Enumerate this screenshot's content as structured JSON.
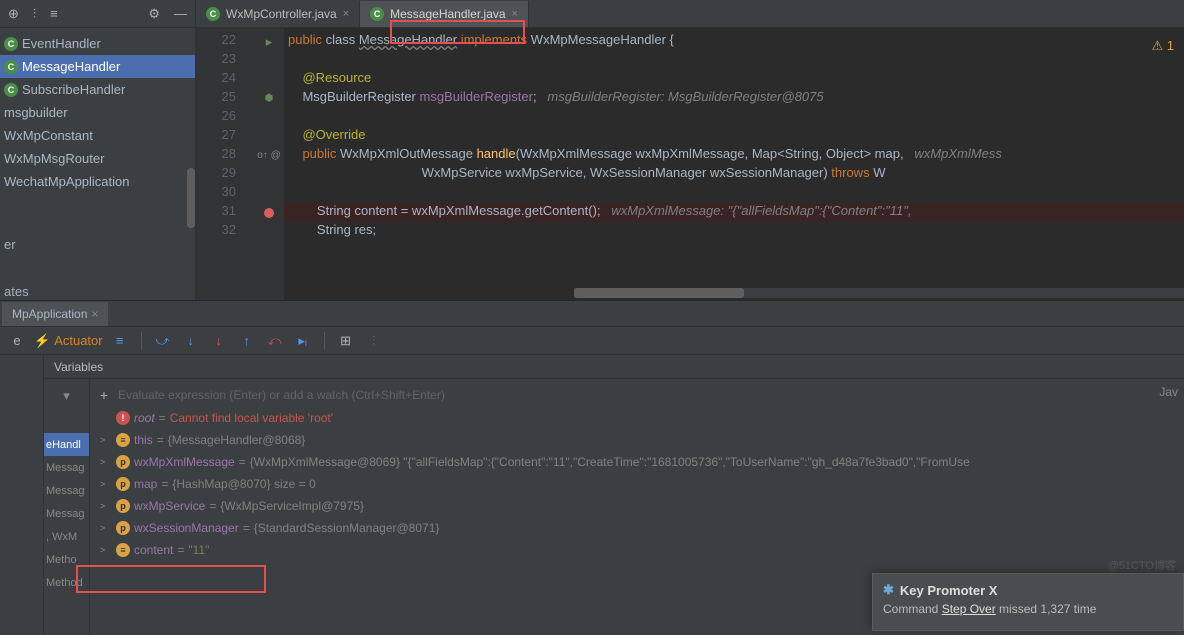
{
  "sidebar": {
    "items": [
      {
        "label": "EventHandler",
        "icon": "C"
      },
      {
        "label": "MessageHandler",
        "icon": "C",
        "selected": true
      },
      {
        "label": "SubscribeHandler",
        "icon": "C"
      },
      {
        "label": "msgbuilder",
        "icon": ""
      },
      {
        "label": "WxMpConstant",
        "icon": ""
      },
      {
        "label": "WxMpMsgRouter",
        "icon": ""
      },
      {
        "label": "WechatMpApplication",
        "icon": ""
      }
    ],
    "partial1": "er",
    "partial2": "ates"
  },
  "tabs": [
    {
      "label": "WxMpController.java",
      "active": false
    },
    {
      "label": "MessageHandler.java",
      "active": true
    }
  ],
  "gutter": [
    "22",
    "23",
    "24",
    "25",
    "26",
    "27",
    "28",
    "29",
    "30",
    "31",
    "32"
  ],
  "code": {
    "l22a": "public",
    "l22b": " class ",
    "l22c": "MessageHandler",
    "l22d": " implements ",
    "l22e": "WxMpMessageHandler ",
    "l22f": "{",
    "l24": "@Resource",
    "l25a": "MsgBuilderRegister ",
    "l25b": "msgBuilderRegister",
    "l25c": ";",
    "l25cmt": "   msgBuilderRegister: MsgBuilderRegister@8075",
    "l27": "@Override",
    "l28a": "public ",
    "l28b": "WxMpXmlOutMessage ",
    "l28c": "handle",
    "l28d": "(WxMpXmlMessage wxMpXmlMessage, Map<String, Object> map,   ",
    "l28e": "wxMpXmlMess",
    "l29a": "WxMpService wxMpService, WxSessionManager wxSessionManager) ",
    "l29b": "throws ",
    "l29c": "W",
    "l31a": "String content = wxMpXmlMessage.getContent();",
    "l31cmt": "   wxMpXmlMessage: \"{\"allFieldsMap\":{\"Content\":\"11\",",
    "l32": "String res;"
  },
  "debug": {
    "tab": "MpApplication",
    "actuator": "Actuator",
    "varsHeader": "Variables",
    "evalPlaceholder": "Evaluate expression (Enter) or add a watch (Ctrl+Shift+Enter)",
    "evalRight": "Jav",
    "frames": [
      "eHandl",
      "Messag",
      "Messag",
      "Messag",
      ", WxM",
      "Metho",
      "Method"
    ],
    "vars": [
      {
        "chev": "",
        "icon": "!",
        "cls": "vi-err",
        "name": "root",
        "eq": " = ",
        "val": "Cannot find local variable 'root'",
        "err": true,
        "nameItalic": true
      },
      {
        "chev": ">",
        "icon": "≡",
        "cls": "vi-f",
        "name": "this",
        "eq": " = ",
        "val": "{MessageHandler@8068}"
      },
      {
        "chev": ">",
        "icon": "p",
        "cls": "vi-p",
        "name": "wxMpXmlMessage",
        "eq": " = ",
        "val": "{WxMpXmlMessage@8069} \"{\"allFieldsMap\":{\"Content\":\"11\",\"CreateTime\":\"1681005736\",\"ToUserName\":\"gh_d48a7fe3bad0\",\"FromUse"
      },
      {
        "chev": ">",
        "icon": "p",
        "cls": "vi-p",
        "name": "map",
        "eq": " = ",
        "val": "{HashMap@8070}  size = 0"
      },
      {
        "chev": ">",
        "icon": "p",
        "cls": "vi-p",
        "name": "wxMpService",
        "eq": " = ",
        "val": "{WxMpServiceImpl@7975}"
      },
      {
        "chev": ">",
        "icon": "p",
        "cls": "vi-p",
        "name": "wxSessionManager",
        "eq": " = ",
        "val": "{StandardSessionManager@8071}"
      },
      {
        "chev": ">",
        "icon": "≡",
        "cls": "vi-f",
        "name": "content",
        "eq": " = ",
        "val": "\"11\"",
        "str": true
      }
    ]
  },
  "popup": {
    "title": "Key Promoter X",
    "body1": "Command ",
    "body2": "Step Over",
    "body3": " missed 1,327 time"
  },
  "watermark": "@51CTO博客"
}
